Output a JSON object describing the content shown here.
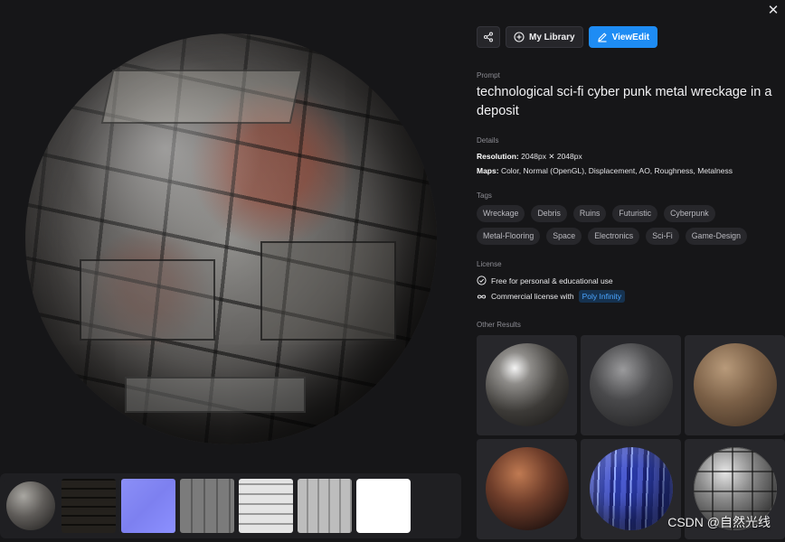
{
  "close": {
    "icon": "close-icon",
    "symbol": "✕"
  },
  "toolbar": {
    "share_icon": "share-icon",
    "library_label": "My Library",
    "library_icon": "plus-circle-icon",
    "view_edit_label": "ViewEdit",
    "view_edit_icon": "edit-icon",
    "accent_color": "#1e8cf4"
  },
  "prompt": {
    "label": "Prompt",
    "text": "technological sci-fi cyber punk metal wreckage in a deposit"
  },
  "details": {
    "label": "Details",
    "resolution_label": "Resolution:",
    "resolution_value": "2048px ✕ 2048px",
    "maps_label": "Maps:",
    "maps_value": "Color, Normal (OpenGL), Displacement, AO, Roughness, Metalness"
  },
  "tags": {
    "label": "Tags",
    "items": [
      "Wreckage",
      "Debris",
      "Ruins",
      "Futuristic",
      "Cyberpunk",
      "Metal-Flooring",
      "Space",
      "Electronics",
      "Sci-Fi",
      "Game-Design"
    ]
  },
  "license": {
    "label": "License",
    "free_text": "Free for personal & educational use",
    "free_icon": "check-circle-icon",
    "commercial_text": "Commercial license with",
    "commercial_icon": "infinity-icon",
    "commercial_link": "Poly Infinity"
  },
  "other_results": {
    "label": "Other Results",
    "items": [
      "result-sphere-1",
      "result-sphere-2",
      "result-sphere-3",
      "result-sphere-4",
      "result-sphere-5",
      "result-sphere-6"
    ]
  },
  "thumbnail_strip": {
    "items": [
      "preview-sphere",
      "color-map",
      "normal-map",
      "displacement-map",
      "ao-map",
      "roughness-map",
      "metalness-map"
    ]
  },
  "watermark": "CSDN @自然光线"
}
